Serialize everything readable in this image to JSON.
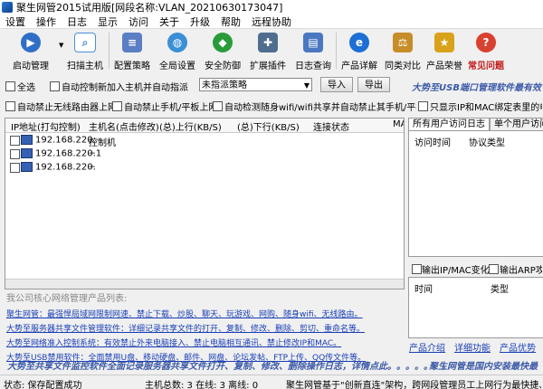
{
  "window": {
    "title": "聚生网管2015试用版[网段名称:VLAN_20210630173047]"
  },
  "menu": [
    "设置",
    "操作",
    "日志",
    "显示",
    "访问",
    "关于",
    "升级",
    "帮助",
    "远程协助"
  ],
  "toolbar": {
    "buttons": [
      {
        "label": "启动管理",
        "icon": "play-icon",
        "color": "#2f6fc7"
      },
      {
        "label": "扫描主机",
        "icon": "magnifier-icon",
        "color": "#4a8fd8"
      },
      {
        "label": "配置策略",
        "icon": "config-icon",
        "color": "#5b7ec4"
      },
      {
        "label": "全局设置",
        "icon": "globe-icon",
        "color": "#3a8fd6"
      },
      {
        "label": "安全防御",
        "icon": "shield-icon",
        "color": "#2a9b3a"
      },
      {
        "label": "扩展插件",
        "icon": "puzzle-icon",
        "color": "#4f6e8f"
      },
      {
        "label": "日志查询",
        "icon": "log-icon",
        "color": "#4a78c0"
      },
      {
        "label": "产品详解",
        "icon": "ie-icon",
        "color": "#1c6fd4"
      },
      {
        "label": "同类对比",
        "icon": "compare-icon",
        "color": "#c78d28"
      },
      {
        "label": "产品荣誉",
        "icon": "trophy-icon",
        "color": "#d9a21b"
      },
      {
        "label": "常见问题",
        "icon": "question-icon",
        "color": "#d84030"
      }
    ]
  },
  "filters": {
    "select_all": "全选",
    "auto_assign_label": "自动控制新加入主机并自动指派",
    "policy_select": "未指派策略",
    "import_btn": "导入",
    "export_btn": "导出",
    "promo1": "大势至USB端口管理软件最有效",
    "auto_block_router": "自动禁止无线路由器上网",
    "auto_block_mobile": "自动禁止手机/平板上网",
    "auto_detect_wifi": "自动检测随身wifi/wifi共享并自动禁止其手机/平板上网",
    "show_ip_mac": "只显示IP和MAC绑定表里的电脑"
  },
  "grid": {
    "columns": [
      "IP地址(打勾控制)",
      "主机名(点击修改)",
      "(总)上行(KB/S)",
      "(总)下行(KB/S)",
      "连接状态",
      "MA"
    ],
    "rows": [
      {
        "ip": "192.168.220.",
        "host": "控制机"
      },
      {
        "ip": "192.168.220.1",
        "host": "--"
      },
      {
        "ip": "192.168.220.",
        "host": "--"
      }
    ]
  },
  "right_panel": {
    "tabs": [
      "所有用户访问日志",
      "单个用户访问日"
    ],
    "col1": "访问时间",
    "col2": "协议类型",
    "chk1": "输出IP/MAC变化",
    "chk2": "输出ARP攻击",
    "col3": "时间",
    "col4": "类型"
  },
  "products": {
    "title": "我公司核心网络管理产品列表:",
    "lines": [
      "聚生网管：最强悍局域网限制网速、禁止下载、炒股、聊天、玩游戏、网购、随身wifi、无线路由。",
      "大势至服务器共享文件管理软件：详细记录共享文件的打开、复制、修改、删除、剪切、重命名等。",
      "大势至网络准入控制系统：有效禁止外来电脑接入、禁止电脑相互通讯、禁止修改IP和MAC。",
      "大势至USB禁用软件：全面禁用U盘、移动硬盘、邮件、网盘、论坛发帖、FTP上传、QQ传文件等。"
    ]
  },
  "links": [
    "产品介绍",
    "详细功能",
    "产品优势"
  ],
  "banner": {
    "left": "大势至共享文件监控软件全面记录服务器共享文件打开、复制、修改、删除操作日志，详情点此。。。。。。。",
    "right": "聚生网管是国内安装最快最"
  },
  "status": {
    "state": "状态: 保存配置成功",
    "hosts": "主机总数: 3  在线: 3  离线: 0",
    "footer": "聚生网管基于\"创新直连\"架构，跨网段管理员工上网行为最快捷、最简单"
  }
}
